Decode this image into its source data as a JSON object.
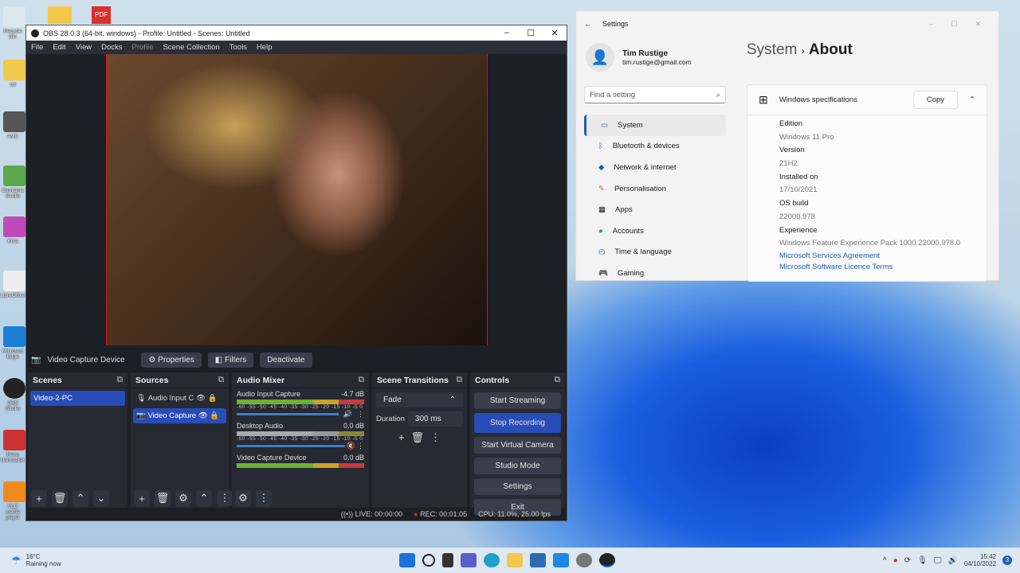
{
  "desktop": {
    "icons": [
      "Recycle Bin",
      "cd",
      "AMC",
      "Camtasia Studio",
      "Krita",
      "LibreOffice",
      "Microsoft Edge",
      "OBS Studio",
      "Revo Uninstaller",
      "VLC media player"
    ]
  },
  "obs": {
    "title": "OBS 28.0.3 (64-bit, windows) - Profile: Untitled - Scenes: Untitled",
    "menu": [
      "File",
      "Edit",
      "View",
      "Docks",
      "Profile",
      "Scene Collection",
      "Tools",
      "Help"
    ],
    "source_bar": {
      "name": "Video Capture Device",
      "properties": "Properties",
      "filters": "Filters",
      "deactivate": "Deactivate"
    },
    "scenes": {
      "title": "Scenes",
      "items": [
        "Video-2-PC"
      ]
    },
    "sources": {
      "title": "Sources",
      "items": [
        "Audio Input C",
        "Video Capture"
      ]
    },
    "mixer": {
      "title": "Audio Mixer",
      "ticks": "-60 -55 -50 -45 -40 -35 -30 -25 -20 -15 -10 -5 0",
      "channels": [
        {
          "name": "Audio Input Capture",
          "db": "-4.7 dB"
        },
        {
          "name": "Desktop Audio",
          "db": "0.0 dB"
        },
        {
          "name": "Video Capture Device",
          "db": "0.0 dB"
        }
      ]
    },
    "transitions": {
      "title": "Scene Transitions",
      "selected": "Fade",
      "duration_label": "Duration",
      "duration": "300 ms"
    },
    "controls": {
      "title": "Controls",
      "buttons": [
        "Start Streaming",
        "Stop Recording",
        "Start Virtual Camera",
        "Studio Mode",
        "Settings",
        "Exit"
      ]
    },
    "status": {
      "live": "LIVE: 00:00:00",
      "rec": "REC: 00:01:05",
      "cpu": "CPU: 11.0%, 25.00 fps"
    }
  },
  "settings": {
    "title": "Settings",
    "user": {
      "name": "Tim Rustige",
      "email": "tim.rustige@gmail.com"
    },
    "search_placeholder": "Find a setting",
    "nav": [
      "System",
      "Bluetooth & devices",
      "Network & internet",
      "Personalisation",
      "Apps",
      "Accounts",
      "Time & language",
      "Gaming"
    ],
    "breadcrumb": {
      "parent": "System",
      "current": "About"
    },
    "specs": {
      "title": "Windows specifications",
      "copy": "Copy",
      "rows": [
        {
          "label": "Edition",
          "value": "Windows 11 Pro"
        },
        {
          "label": "Version",
          "value": "21H2"
        },
        {
          "label": "Installed on",
          "value": "17/10/2021"
        },
        {
          "label": "OS build",
          "value": "22000.978"
        },
        {
          "label": "Experience",
          "value": "Windows Feature Experience Pack 1000.22000.978.0"
        }
      ],
      "links": [
        "Microsoft Services Agreement",
        "Microsoft Software Licence Terms"
      ]
    }
  },
  "taskbar": {
    "weather_temp": "16°C",
    "weather_desc": "Raining now",
    "time": "15:42",
    "date": "04/10/2022",
    "badge": "3"
  }
}
